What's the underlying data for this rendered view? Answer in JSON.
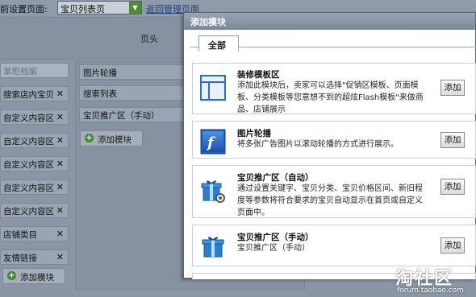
{
  "topbar": {
    "label": "前设置页面:",
    "select_value": "宝贝列表页",
    "back_link": "返回管理页面"
  },
  "header_region": {
    "label": "页头"
  },
  "left_column": {
    "items": [
      {
        "label": "掌柜档案",
        "ghost": true
      },
      {
        "label": "搜索店内宝贝",
        "close": "✕"
      },
      {
        "label": "自定义内容区",
        "close": "✕"
      },
      {
        "label": "自定义内容区",
        "close": "✕"
      },
      {
        "label": "自定义内容区",
        "close": "✕"
      },
      {
        "label": "自定义内容区",
        "close": "✕"
      },
      {
        "label": "自定义内容区",
        "close": "✕"
      },
      {
        "label": "店铺类目",
        "close": "✕"
      },
      {
        "label": "友情链接",
        "close": "✕"
      }
    ],
    "add_label": "添加模块"
  },
  "middle_column": {
    "items": [
      "图片轮播",
      "搜索列表",
      "宝贝推广区（手动）"
    ],
    "add_label": "添加模块"
  },
  "modal": {
    "title": "添加模块",
    "tab": "全部",
    "modules": [
      {
        "name": "装修模板区",
        "desc": "添加此模块后，卖家可以选择\"促销区模板、页面模板、分类模板等您意想不到的超炫Flash模板\"来做商品、店铺展示",
        "button": "添加",
        "icon": "layout-template-icon"
      },
      {
        "name": "图片轮播",
        "desc": "将多张广告图片以滚动轮播的方式进行展示。",
        "button": "添加",
        "icon": "flash-icon"
      },
      {
        "name": "宝贝推广区（自动）",
        "desc": "通过设置关键字、宝贝分类、宝贝价格区间、新旧程度等参数将符合要求的宝贝自动显示在首页或自定义页面中。",
        "button": "添加",
        "icon": "gift-gear-icon"
      },
      {
        "name": "宝贝推广区（手动）",
        "desc": "宝贝推广区（手动）",
        "button": "添加",
        "icon": "gift-icon"
      }
    ]
  },
  "watermark": {
    "logo": "淘社区",
    "url": "forum.taobao.com"
  },
  "colors": {
    "accent_blue": "#2a6fc4",
    "add_green": "#3c8a2c",
    "modal_title_bg": "#8a95a4"
  }
}
